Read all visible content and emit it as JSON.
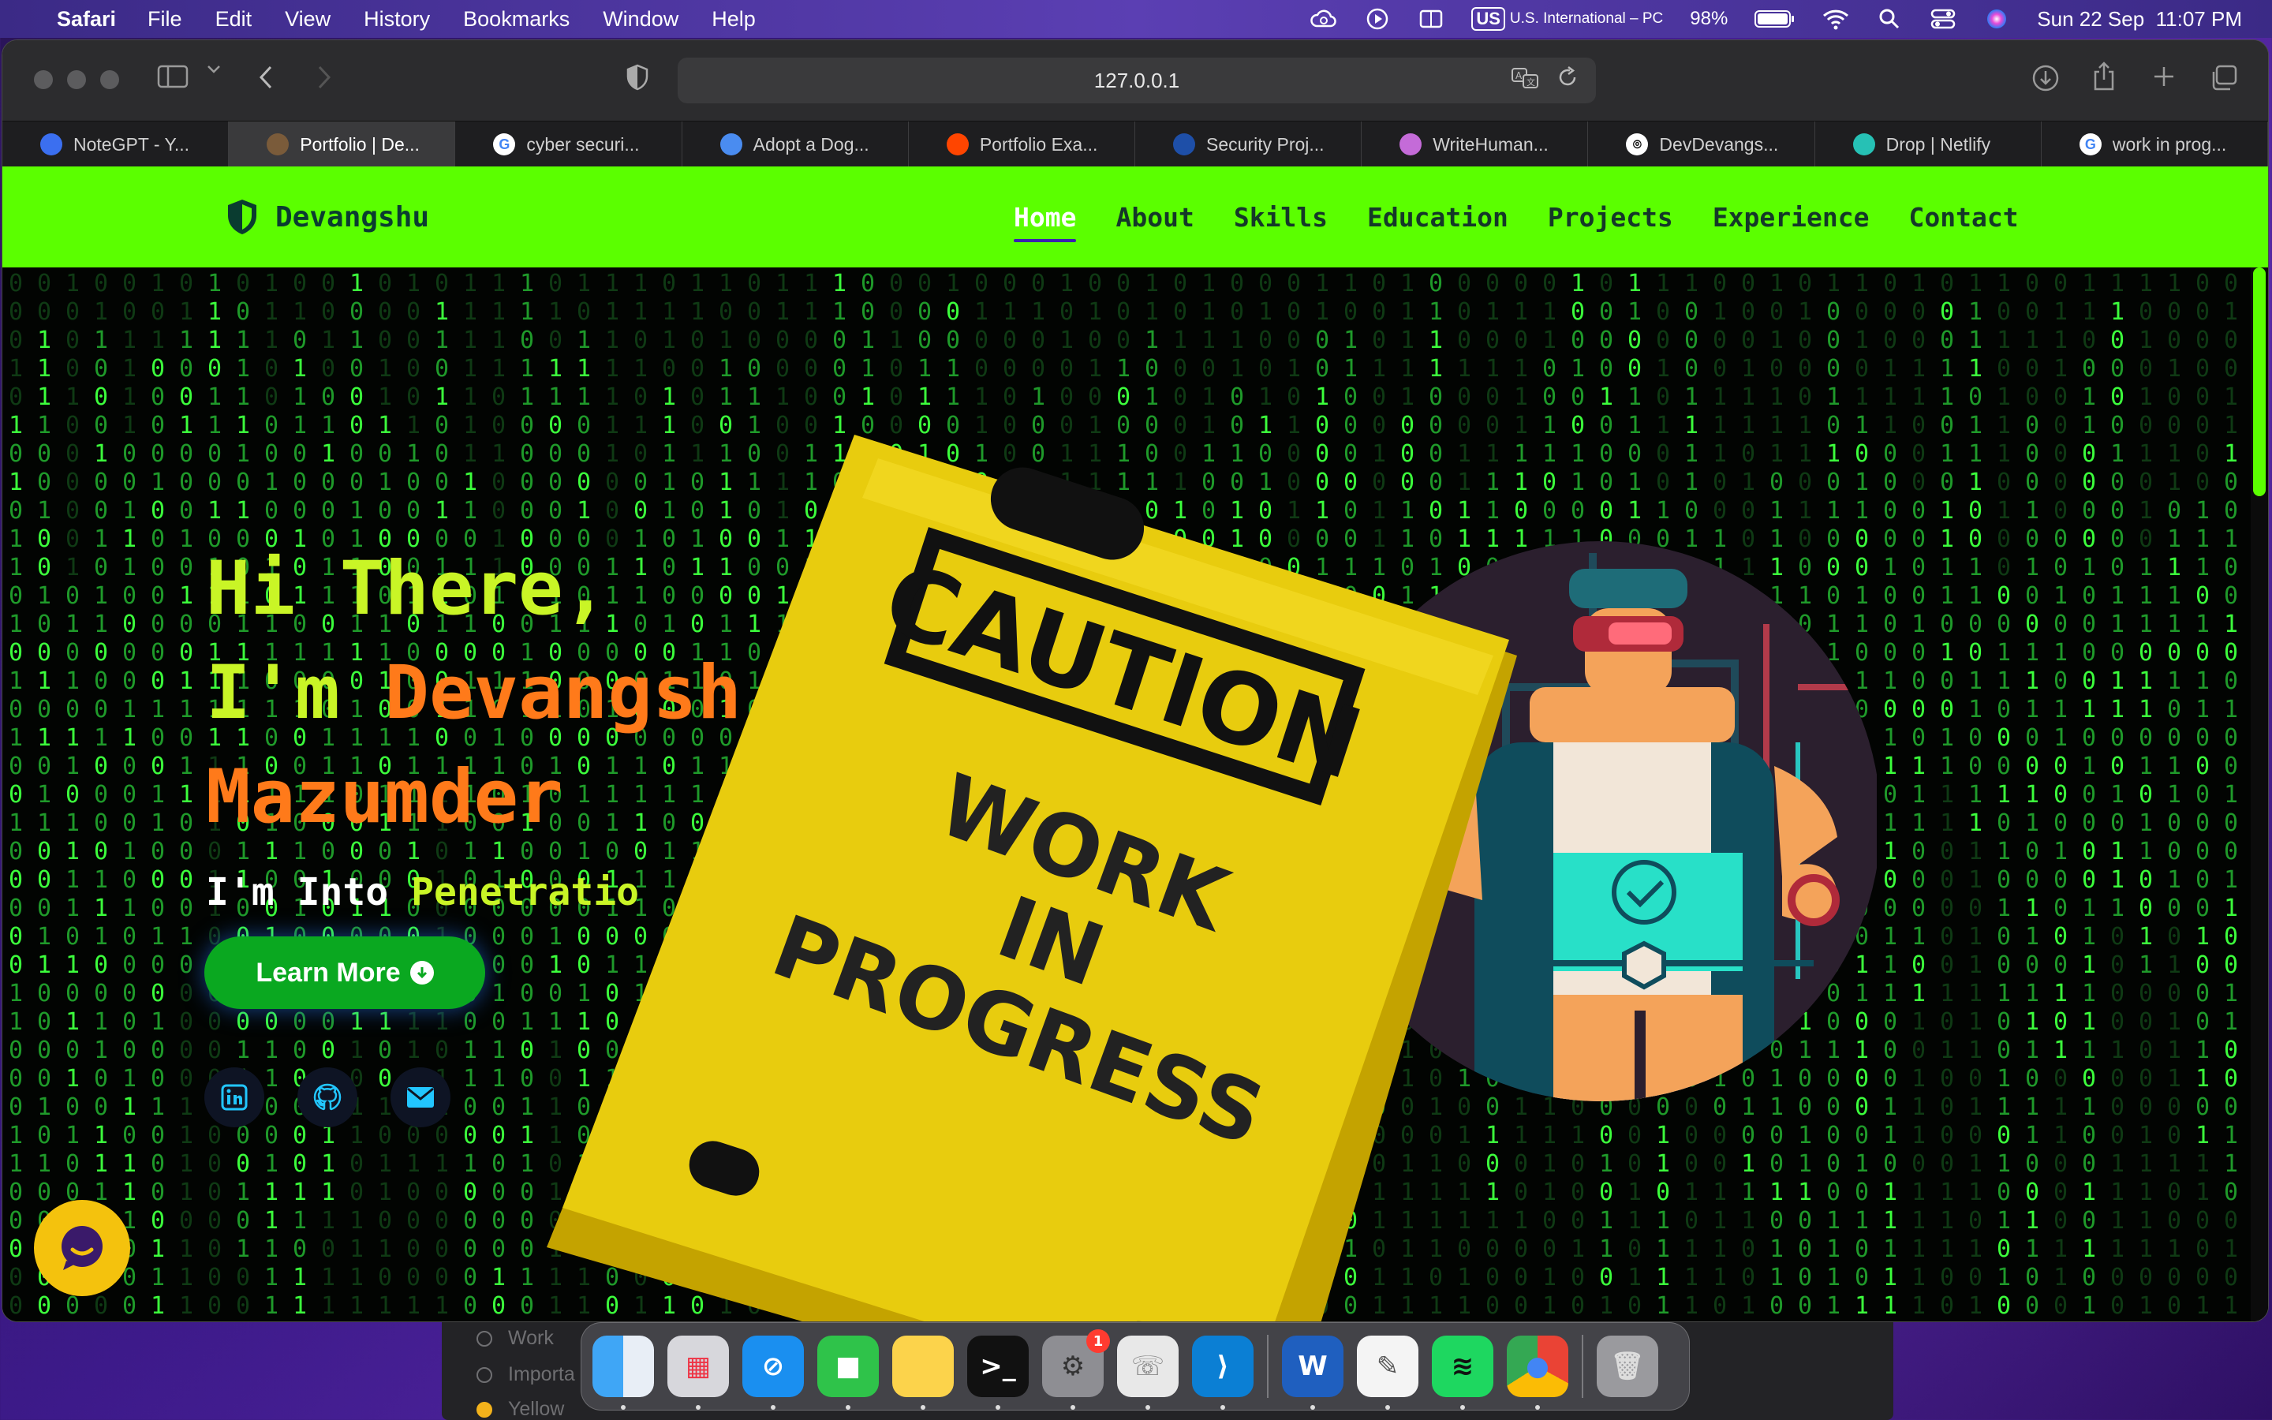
{
  "menubar": {
    "app_name": "Safari",
    "items": [
      "File",
      "Edit",
      "View",
      "History",
      "Bookmarks",
      "Window",
      "Help"
    ],
    "keyboard_badge": "US",
    "keyboard_label": "U.S. International – PC",
    "battery": "98%",
    "datetime": "Sun 22 Sep  11:07 PM"
  },
  "browser": {
    "url": "127.0.0.1",
    "tabs": [
      {
        "label": "NoteGPT - Y...",
        "icon": "notegpt-icon",
        "color": "#3b6ff0"
      },
      {
        "label": "Portfolio | De...",
        "icon": "portfolio-icon",
        "color": "#7a5b3a",
        "active": true
      },
      {
        "label": "cyber securi...",
        "icon": "google-icon",
        "color": "#ffffff"
      },
      {
        "label": "Adopt a Dog...",
        "icon": "puzzle-icon",
        "color": "#4a8cf0"
      },
      {
        "label": "Portfolio Exa...",
        "icon": "reddit-icon",
        "color": "#ff4500"
      },
      {
        "label": "Security Proj...",
        "icon": "x-icon",
        "color": "#1e4fa8"
      },
      {
        "label": "WriteHuman...",
        "icon": "writehuman-icon",
        "color": "#c46bd8"
      },
      {
        "label": "DevDevangs...",
        "icon": "github-icon",
        "color": "#ffffff"
      },
      {
        "label": "Drop | Netlify",
        "icon": "netlify-icon",
        "color": "#26c1b5"
      },
      {
        "label": "work in prog...",
        "icon": "google-icon",
        "color": "#ffffff"
      }
    ]
  },
  "site": {
    "brand": "Devangshu",
    "nav": [
      "Home",
      "About",
      "Skills",
      "Education",
      "Projects",
      "Experience",
      "Contact"
    ],
    "active_nav": "Home",
    "hero": {
      "line1": "Hi There,",
      "line2_prefix": "I'm ",
      "line2_name": "Devangsh",
      "line3": "Mazumder",
      "sub_prefix": "I'm Into ",
      "sub_role": "Penetratio"
    },
    "cta": "Learn More",
    "socials": [
      "linkedin-icon",
      "github-icon",
      "email-icon"
    ],
    "caution_sign": {
      "top": "CAUTION",
      "body": [
        "WORK",
        "IN",
        "PROGRESS"
      ]
    },
    "accent": "#5bff00",
    "name_color": "#ff7a1a",
    "greeting_color": "#c9f526"
  },
  "background_window": {
    "items": [
      "Work",
      "Importa",
      "Yellow"
    ]
  },
  "dock": {
    "apps": [
      "Finder",
      "Launchpad",
      "Safari",
      "FaceTime",
      "Notes",
      "Terminal",
      "System Settings",
      "WhatsApp",
      "Visual Studio Code",
      "Microsoft Word",
      "TextEdit",
      "Spotify",
      "Google Chrome",
      "Trash"
    ],
    "settings_badge": "1"
  }
}
